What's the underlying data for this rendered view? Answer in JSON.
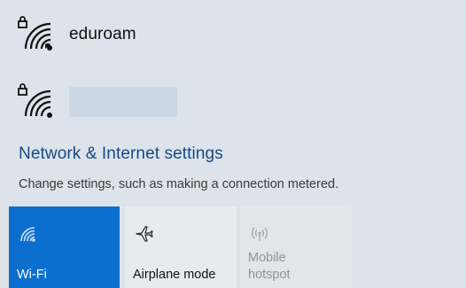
{
  "networks": [
    {
      "name": "eduroam",
      "icon": "wifi-secured-icon"
    },
    {
      "name": "",
      "icon": "wifi-secured-icon"
    }
  ],
  "settings": {
    "link_label": "Network & Internet settings",
    "description": "Change settings, such as making a connection metered."
  },
  "quick_actions": [
    {
      "label": "Wi-Fi",
      "icon": "wifi-icon",
      "state": "on"
    },
    {
      "label": "Airplane mode",
      "icon": "airplane-icon",
      "state": "off"
    },
    {
      "label": "Mobile hotspot",
      "icon": "hotspot-icon",
      "state": "disabled"
    }
  ],
  "colors": {
    "background": "#dce3ea",
    "accent": "#0b6fcf",
    "link": "#174a82"
  }
}
